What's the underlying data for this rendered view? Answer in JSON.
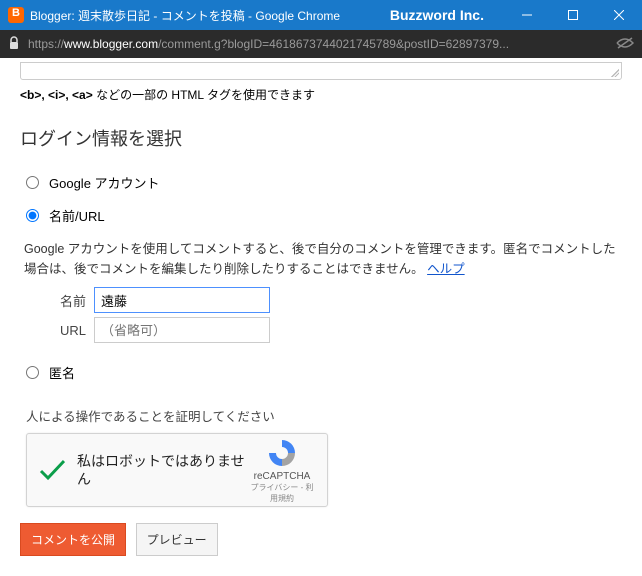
{
  "window": {
    "title": "Blogger: 週末散歩日記 - コメントを投稿 - Google Chrome",
    "brand": "Buzzword Inc."
  },
  "addressbar": {
    "scheme": "https://",
    "host": "www.blogger.com",
    "path": "/comment.g?blogID=4618673744021745789&postID=62897379..."
  },
  "hint_prefix": "<b>, <i>, <a> ",
  "hint_rest": "などの一部の HTML タグを使用できます",
  "section_title": "ログイン情報を選択",
  "radios": {
    "google": "Google アカウント",
    "nameurl": "名前/URL",
    "anon": "匿名"
  },
  "desc_main": "Google アカウントを使用してコメントすると、後で自分のコメントを管理できます。匿名でコメントした場合は、後でコメントを編集したり削除したりすることはできません。",
  "desc_help": "ヘルプ",
  "fields": {
    "name_label": "名前",
    "name_value": "遠藤",
    "url_label": "URL",
    "url_placeholder": "（省略可）"
  },
  "verify_label": "人による操作であることを証明してください",
  "recaptcha": {
    "label": "私はロボットではありません",
    "name": "reCAPTCHA",
    "terms": "プライバシー - 利用規約"
  },
  "buttons": {
    "publish": "コメントを公開",
    "preview": "プレビュー"
  }
}
